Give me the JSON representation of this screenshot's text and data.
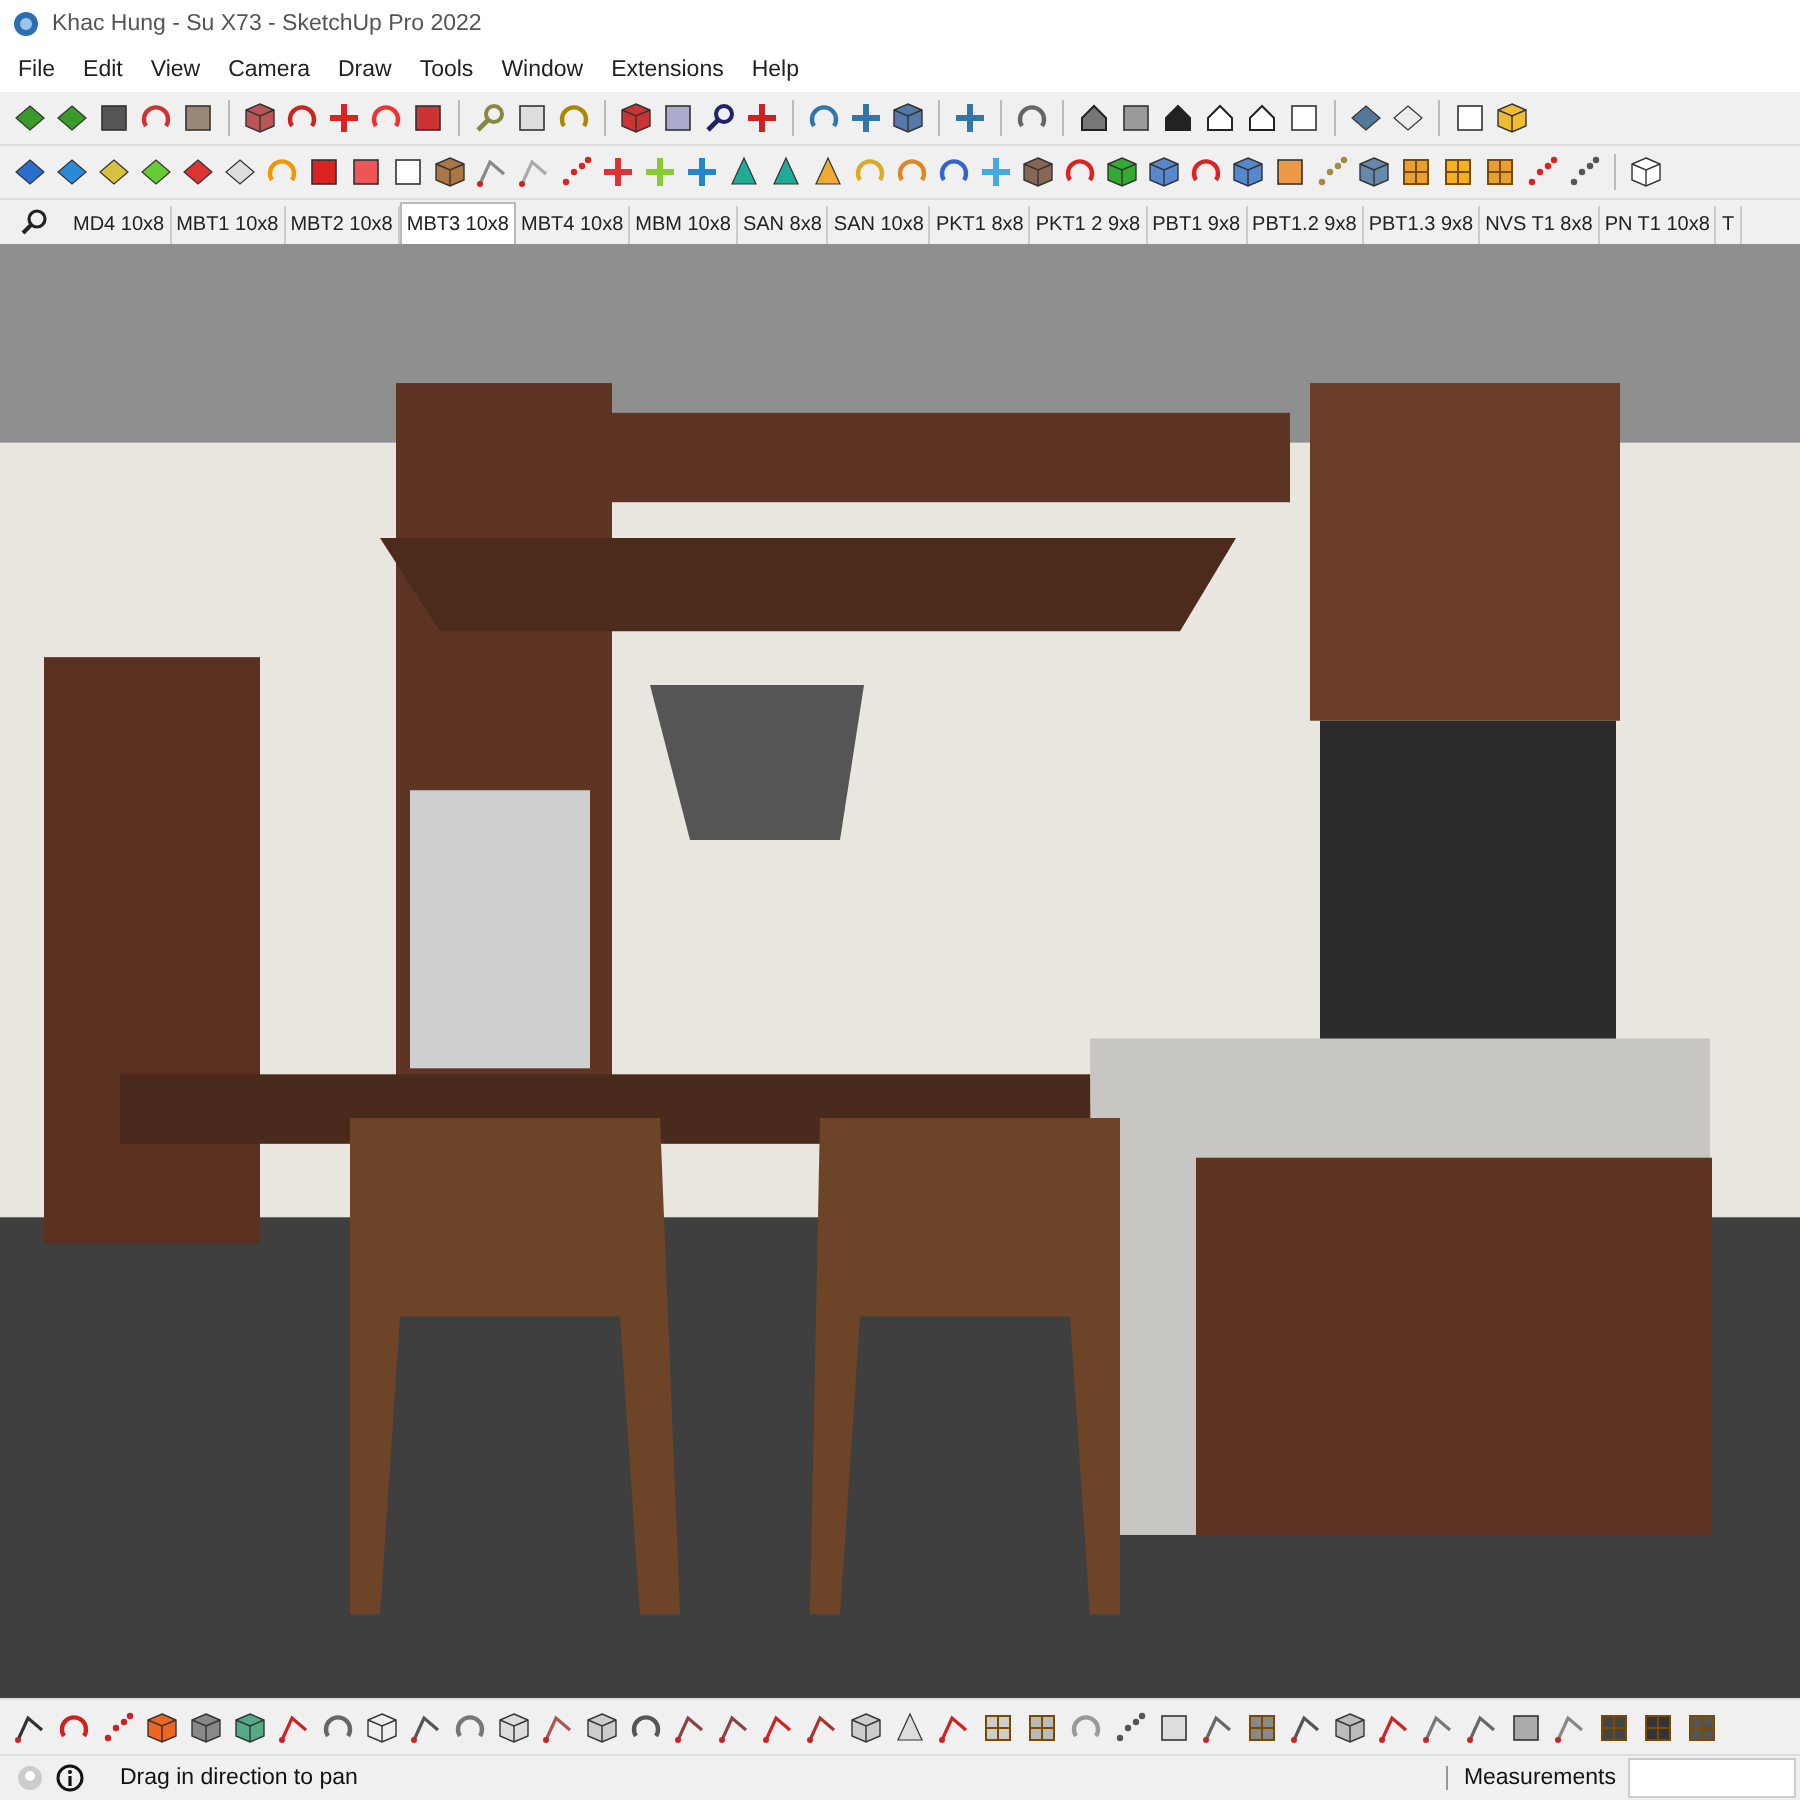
{
  "window": {
    "title": "Khac Hung - Su X73 - SketchUp Pro 2022"
  },
  "menu": [
    "File",
    "Edit",
    "View",
    "Camera",
    "Draw",
    "Tools",
    "Window",
    "Extensions",
    "Help"
  ],
  "scene_tabs": [
    {
      "label": "MD4 10x8",
      "selected": false
    },
    {
      "label": "MBT1 10x8",
      "selected": false
    },
    {
      "label": "MBT2 10x8",
      "selected": false
    },
    {
      "label": "MBT3 10x8",
      "selected": true
    },
    {
      "label": "MBT4 10x8",
      "selected": false
    },
    {
      "label": "MBM 10x8",
      "selected": false
    },
    {
      "label": "SAN 8x8",
      "selected": false
    },
    {
      "label": "SAN 10x8",
      "selected": false
    },
    {
      "label": "PKT1 8x8",
      "selected": false
    },
    {
      "label": "PKT1 2 9x8",
      "selected": false
    },
    {
      "label": "PBT1 9x8",
      "selected": false
    },
    {
      "label": "PBT1.2 9x8",
      "selected": false
    },
    {
      "label": "PBT1.3 9x8",
      "selected": false
    },
    {
      "label": "NVS T1 8x8",
      "selected": false
    },
    {
      "label": "PN T1 10x8",
      "selected": false
    },
    {
      "label": "T",
      "selected": false
    }
  ],
  "status_bar": {
    "hint": "Drag in direction to pan",
    "measurements_label": "Measurements"
  }
}
